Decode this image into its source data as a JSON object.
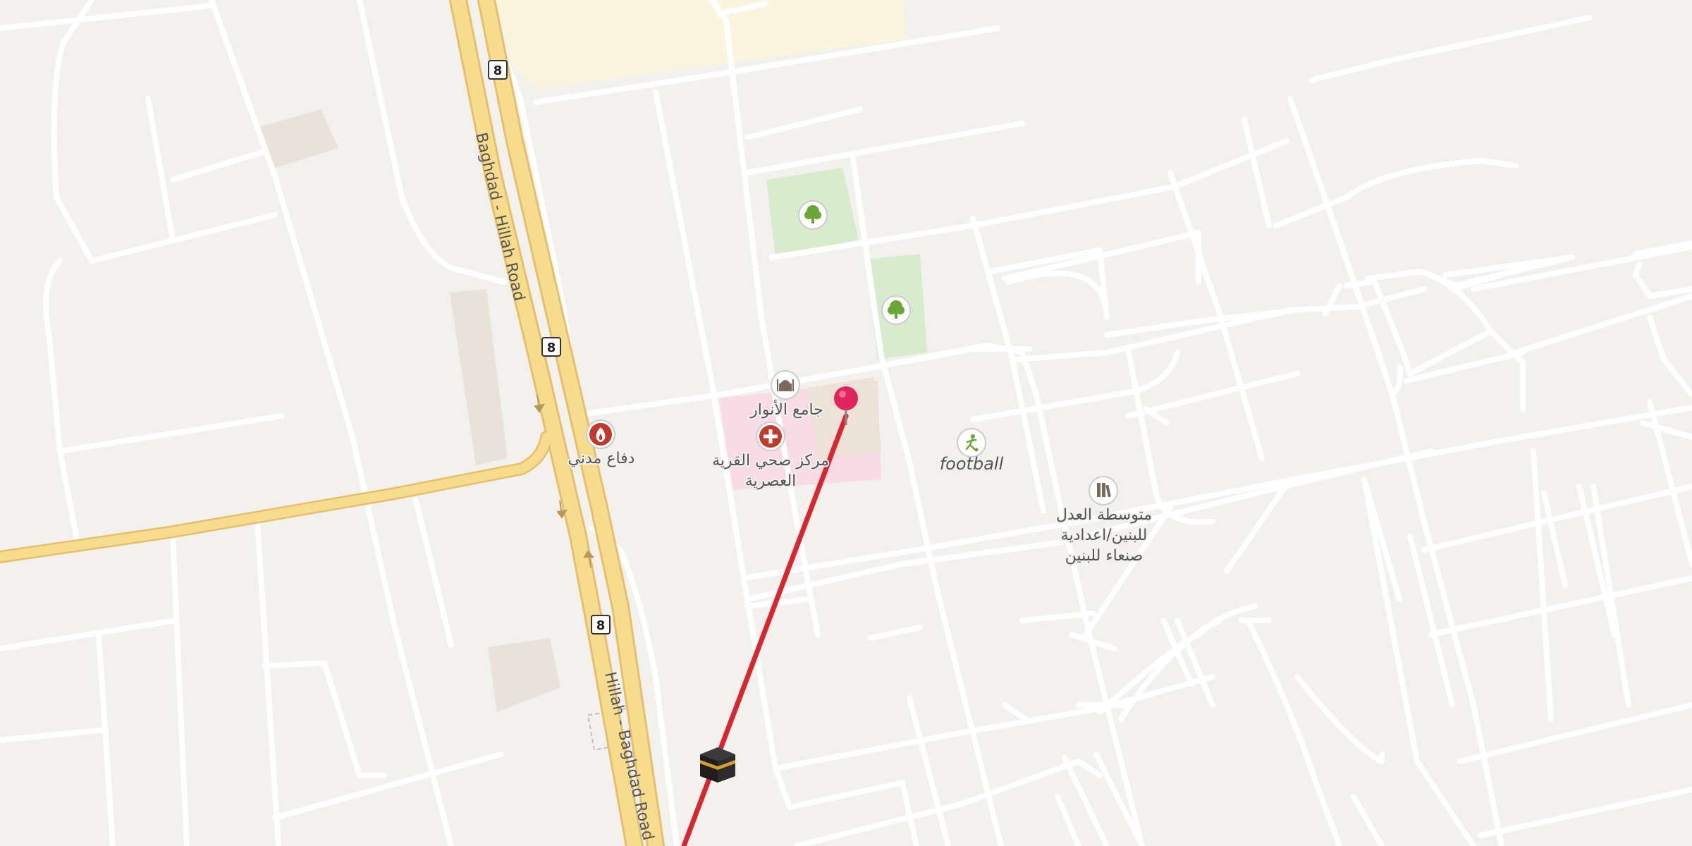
{
  "map": {
    "road_names": {
      "baghdad_hillah_north": "Baghdad - Hillah Road",
      "hillah_baghdad_south": "Hillah - Baghdad Road"
    },
    "route_shield": "8",
    "pois": {
      "mosque": "جامع الأنوار",
      "clinic_line1": "مركز صحي القرية",
      "clinic_line2": "العصرية",
      "civil_defense": "دفاع مدني",
      "sports": "football",
      "school_line1": "متوسطة العدل",
      "school_line2": "للبنين/اعدادية",
      "school_line3": "صنعاء للبنين"
    },
    "icons": {
      "pin": "location-pin-icon",
      "qibla": "kaaba-icon",
      "park": "tree-icon",
      "mosque": "mosque-icon",
      "clinic": "medical-cross-icon",
      "fire": "fire-station-icon",
      "sport": "football-player-icon",
      "school": "school-icon"
    },
    "colors": {
      "background": "#f3f1ee",
      "minor_road": "#ffffff",
      "major_road": "#f7dc8e",
      "major_road_casing": "#e6bf6a",
      "park": "#d8ebcc",
      "hospital_area": "#f9dbe6",
      "industrial_area": "#fbf5de",
      "building": "#e8e2da",
      "qibla_line": "#d9262e",
      "pin": "#e0245e"
    }
  }
}
